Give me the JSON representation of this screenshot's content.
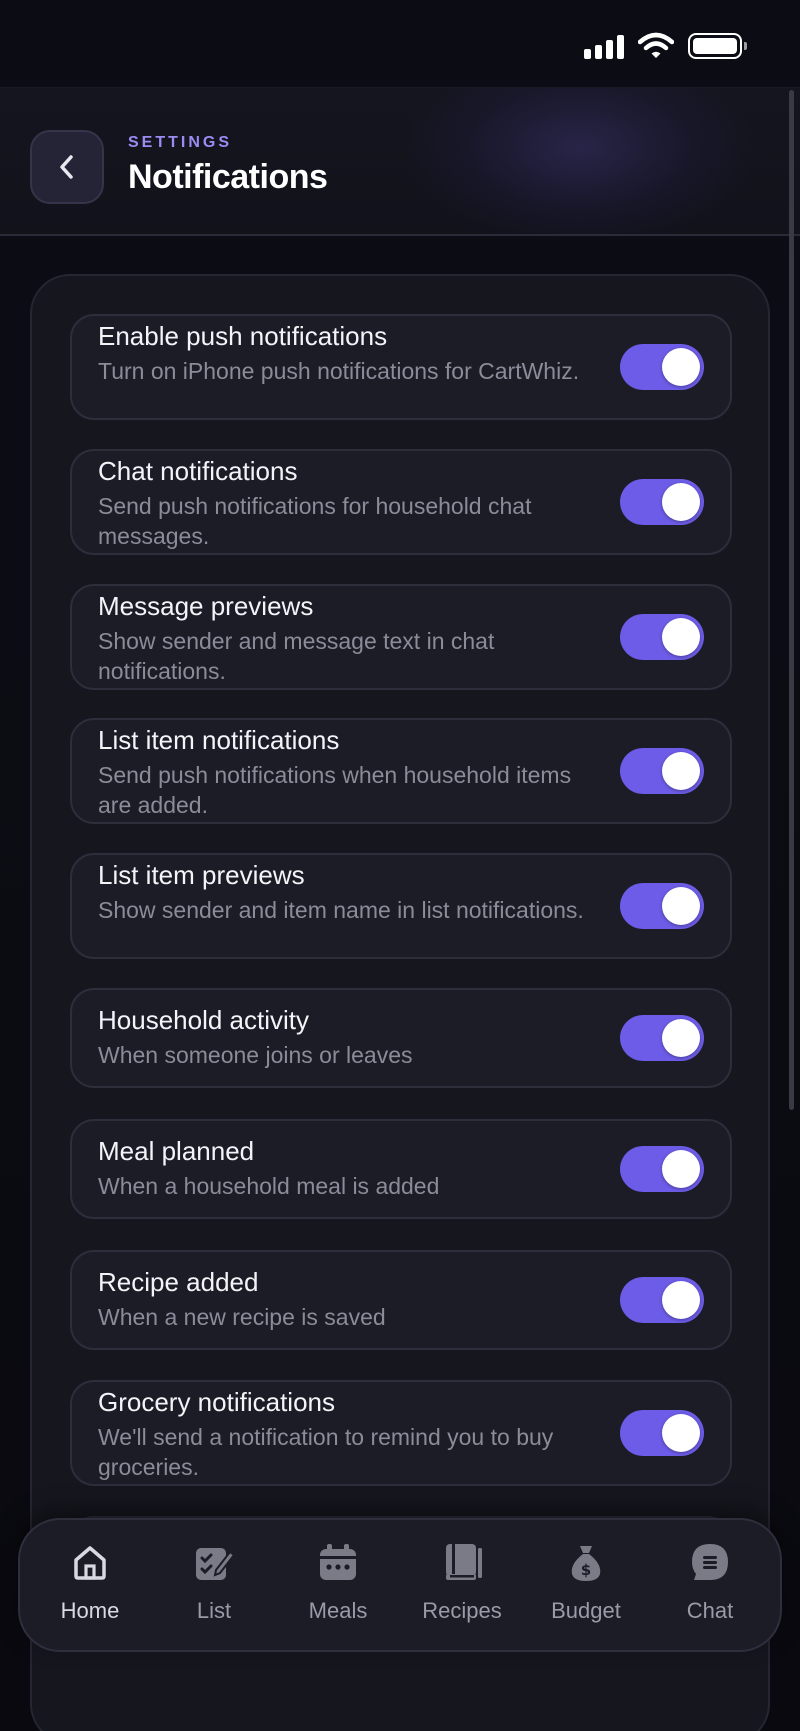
{
  "status_bar": {
    "icons": [
      "cellular-signal-icon",
      "wifi-icon",
      "battery-icon"
    ]
  },
  "header": {
    "eyebrow": "SETTINGS",
    "title": "Notifications",
    "back_icon": "chevron-left-icon"
  },
  "settings": [
    {
      "title": "Enable push notifications",
      "description": "Turn on iPhone push notifications for CartWhiz.",
      "enabled": true
    },
    {
      "title": "Chat notifications",
      "description": "Send push notifications for household chat messages.",
      "enabled": true
    },
    {
      "title": "Message previews",
      "description": "Show sender and message text in chat notifications.",
      "enabled": true
    },
    {
      "title": "List item notifications",
      "description": "Send push notifications when household items are added.",
      "enabled": true
    },
    {
      "title": "List item previews",
      "description": "Show sender and item name in list notifications.",
      "enabled": true
    },
    {
      "title": "Household activity",
      "description": "When someone joins or leaves",
      "enabled": true
    },
    {
      "title": "Meal planned",
      "description": "When a household meal is added",
      "enabled": true
    },
    {
      "title": "Recipe added",
      "description": "When a new recipe is saved",
      "enabled": true
    },
    {
      "title": "Grocery notifications",
      "description": "We'll send a notification to remind you to buy groceries.",
      "enabled": true
    }
  ],
  "tabs": [
    {
      "label": "Home",
      "icon": "home-icon"
    },
    {
      "label": "List",
      "icon": "list-icon"
    },
    {
      "label": "Meals",
      "icon": "calendar-icon"
    },
    {
      "label": "Recipes",
      "icon": "book-icon"
    },
    {
      "label": "Budget",
      "icon": "money-bag-icon"
    },
    {
      "label": "Chat",
      "icon": "chat-icon"
    }
  ],
  "colors": {
    "accent": "#6c5ce7",
    "eyebrow": "#9a8cf5",
    "background": "#0b0b12",
    "card": "#16161f",
    "row": "#1c1c27"
  }
}
